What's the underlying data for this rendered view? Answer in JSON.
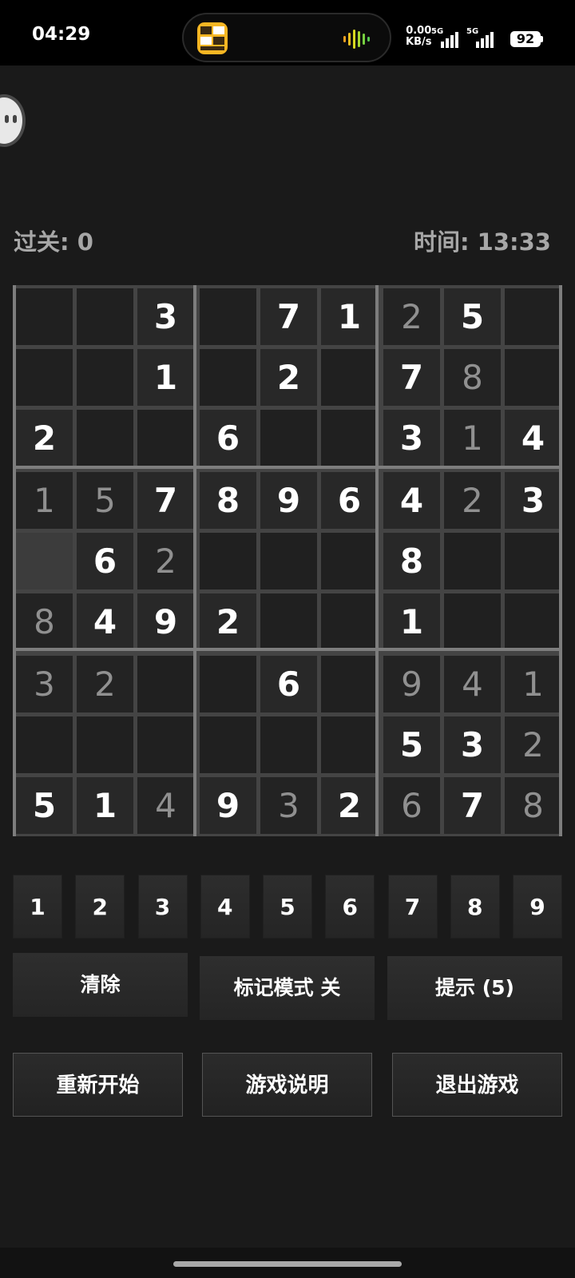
{
  "status": {
    "time": "04:29",
    "net_speed_value": "0.00",
    "net_speed_unit": "KB/s",
    "sim1": "5G",
    "sim2": "5G",
    "battery": "92"
  },
  "header": {
    "level": "过关: 0",
    "timer": "时间: 13:33"
  },
  "board": {
    "rows": [
      [
        "",
        "",
        "3",
        "",
        "7",
        "1",
        "2",
        "5",
        ""
      ],
      [
        "",
        "",
        "1",
        "",
        "2",
        "",
        "7",
        "8",
        ""
      ],
      [
        "2",
        "",
        "",
        "6",
        "",
        "",
        "3",
        "1",
        "4"
      ],
      [
        "1",
        "5",
        "7",
        "8",
        "9",
        "6",
        "4",
        "2",
        "3"
      ],
      [
        "",
        "6",
        "2",
        "",
        "",
        "",
        "8",
        "",
        ""
      ],
      [
        "8",
        "4",
        "9",
        "2",
        "",
        "",
        "1",
        "",
        ""
      ],
      [
        "3",
        "2",
        "",
        "",
        "6",
        "",
        "9",
        "4",
        "1"
      ],
      [
        "",
        "",
        "",
        "",
        "",
        "",
        "5",
        "3",
        "2"
      ],
      [
        "5",
        "1",
        "4",
        "9",
        "3",
        "2",
        "6",
        "7",
        "8"
      ]
    ],
    "kinds": [
      [
        "e",
        "e",
        "g",
        "e",
        "g",
        "g",
        "f",
        "g",
        "e"
      ],
      [
        "e",
        "e",
        "g",
        "e",
        "g",
        "e",
        "g",
        "f",
        "e"
      ],
      [
        "g",
        "e",
        "e",
        "g",
        "e",
        "e",
        "g",
        "f",
        "g"
      ],
      [
        "f",
        "f",
        "g",
        "g",
        "g",
        "g",
        "g",
        "f",
        "g"
      ],
      [
        "s",
        "g",
        "f",
        "e",
        "e",
        "e",
        "g",
        "e",
        "e"
      ],
      [
        "f",
        "g",
        "g",
        "g",
        "e",
        "e",
        "g",
        "e",
        "e"
      ],
      [
        "f",
        "f",
        "e",
        "e",
        "g",
        "e",
        "f",
        "f",
        "f"
      ],
      [
        "e",
        "e",
        "e",
        "e",
        "e",
        "e",
        "g",
        "g",
        "f"
      ],
      [
        "g",
        "g",
        "f",
        "g",
        "f",
        "g",
        "f",
        "g",
        "f"
      ]
    ]
  },
  "numpad": [
    "1",
    "2",
    "3",
    "4",
    "5",
    "6",
    "7",
    "8",
    "9"
  ],
  "actions": {
    "clear": "清除",
    "mark_mode": "标记模式 关",
    "hint": "提示 (5)"
  },
  "menu": {
    "restart": "重新开始",
    "help": "游戏说明",
    "exit": "退出游戏"
  },
  "colors": {
    "background": "#1a1a1a",
    "given_digit": "#ffffff",
    "filled_digit": "#909090",
    "label_gray": "#a7a7a7"
  },
  "icons": {
    "island_app": "puzzle-app-icon",
    "island_wave": "audio-wave-icon",
    "float_ball": "assistant-bubble-icon"
  }
}
